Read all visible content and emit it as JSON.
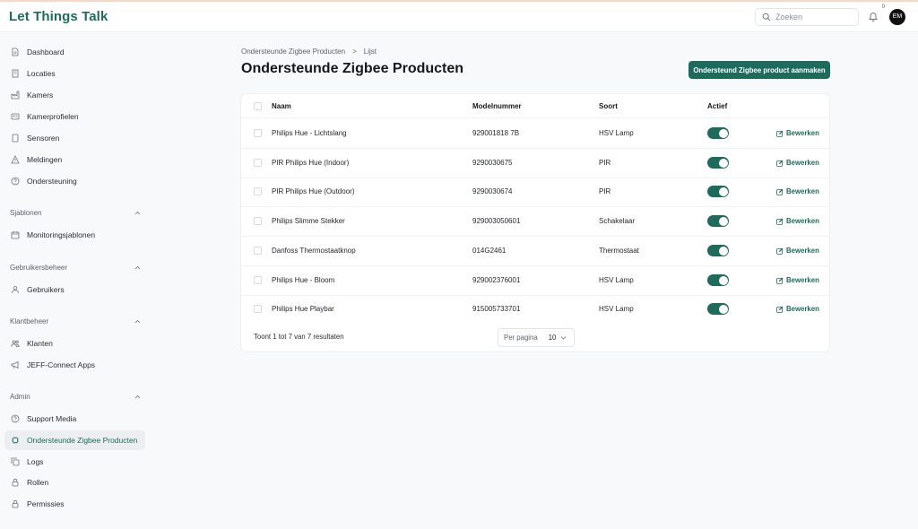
{
  "app": {
    "logo": "Let Things Talk"
  },
  "topbar": {
    "search_placeholder": "Zoeken",
    "notification_count": "0",
    "avatar_initials": "EM"
  },
  "sidebar": {
    "main": [
      {
        "label": "Dashboard",
        "icon": "document-icon"
      },
      {
        "label": "Locaties",
        "icon": "building-icon"
      },
      {
        "label": "Kamers",
        "icon": "factory-icon"
      },
      {
        "label": "Kamerprofielen",
        "icon": "id-card-icon"
      },
      {
        "label": "Sensoren",
        "icon": "tablet-icon"
      },
      {
        "label": "Meldingen",
        "icon": "warning-icon"
      },
      {
        "label": "Ondersteuning",
        "icon": "help-circle-icon"
      }
    ],
    "sections": [
      {
        "title": "Sjablonen",
        "items": [
          {
            "label": "Monitoringsjablonen",
            "icon": "calendar-icon"
          }
        ]
      },
      {
        "title": "Gebruikersbeheer",
        "items": [
          {
            "label": "Gebruikers",
            "icon": "user-icon"
          }
        ]
      },
      {
        "title": "Klantbeheer",
        "items": [
          {
            "label": "Klanten",
            "icon": "users-icon"
          },
          {
            "label": "JEFF-Connect Apps",
            "icon": "megaphone-icon"
          }
        ]
      },
      {
        "title": "Admin",
        "items": [
          {
            "label": "Support Media",
            "icon": "help-circle-icon"
          },
          {
            "label": "Ondersteunde Zigbee Producten",
            "icon": "chip-icon",
            "active": true
          },
          {
            "label": "Logs",
            "icon": "copy-icon"
          },
          {
            "label": "Rollen",
            "icon": "lock-icon"
          },
          {
            "label": "Permissies",
            "icon": "lock-icon"
          }
        ]
      }
    ]
  },
  "breadcrumb": {
    "parent": "Ondersteunde Zigbee Producten",
    "separator": ">",
    "current": "Lijst"
  },
  "page": {
    "title": "Ondersteunde Zigbee Producten",
    "create_button": "Ondersteund Zigbee product aanmaken"
  },
  "table": {
    "columns": {
      "name": "Naam",
      "model": "Modelnummer",
      "type": "Soort",
      "active": "Actief"
    },
    "edit_label": "Bewerken",
    "rows": [
      {
        "name": "Philips Hue - Lichtslang",
        "model": "929001818 7B",
        "type": "HSV Lamp",
        "active": true
      },
      {
        "name": "PIR Philips Hue (Indoor)",
        "model": "9290030675",
        "type": "PIR",
        "active": true
      },
      {
        "name": "PIR Philips Hue (Outdoor)",
        "model": "9290030674",
        "type": "PIR",
        "active": true
      },
      {
        "name": "Philips Slimme Stekker",
        "model": "929003050601",
        "type": "Schakelaar",
        "active": true
      },
      {
        "name": "Danfoss Thermostaatknop",
        "model": "014G2461",
        "type": "Thermostaat",
        "active": true
      },
      {
        "name": "Philips Hue - Bloom",
        "model": "929002376001",
        "type": "HSV Lamp",
        "active": true
      },
      {
        "name": "Philips Hue Playbar",
        "model": "915005733701",
        "type": "HSV Lamp",
        "active": true
      }
    ],
    "footer": {
      "summary": "Toont 1 tot 7 van 7 resultaten",
      "per_page_label": "Per pagina",
      "per_page_value": "10"
    }
  },
  "colors": {
    "brand": "#1e6b5e",
    "background": "#f8f9fb"
  }
}
